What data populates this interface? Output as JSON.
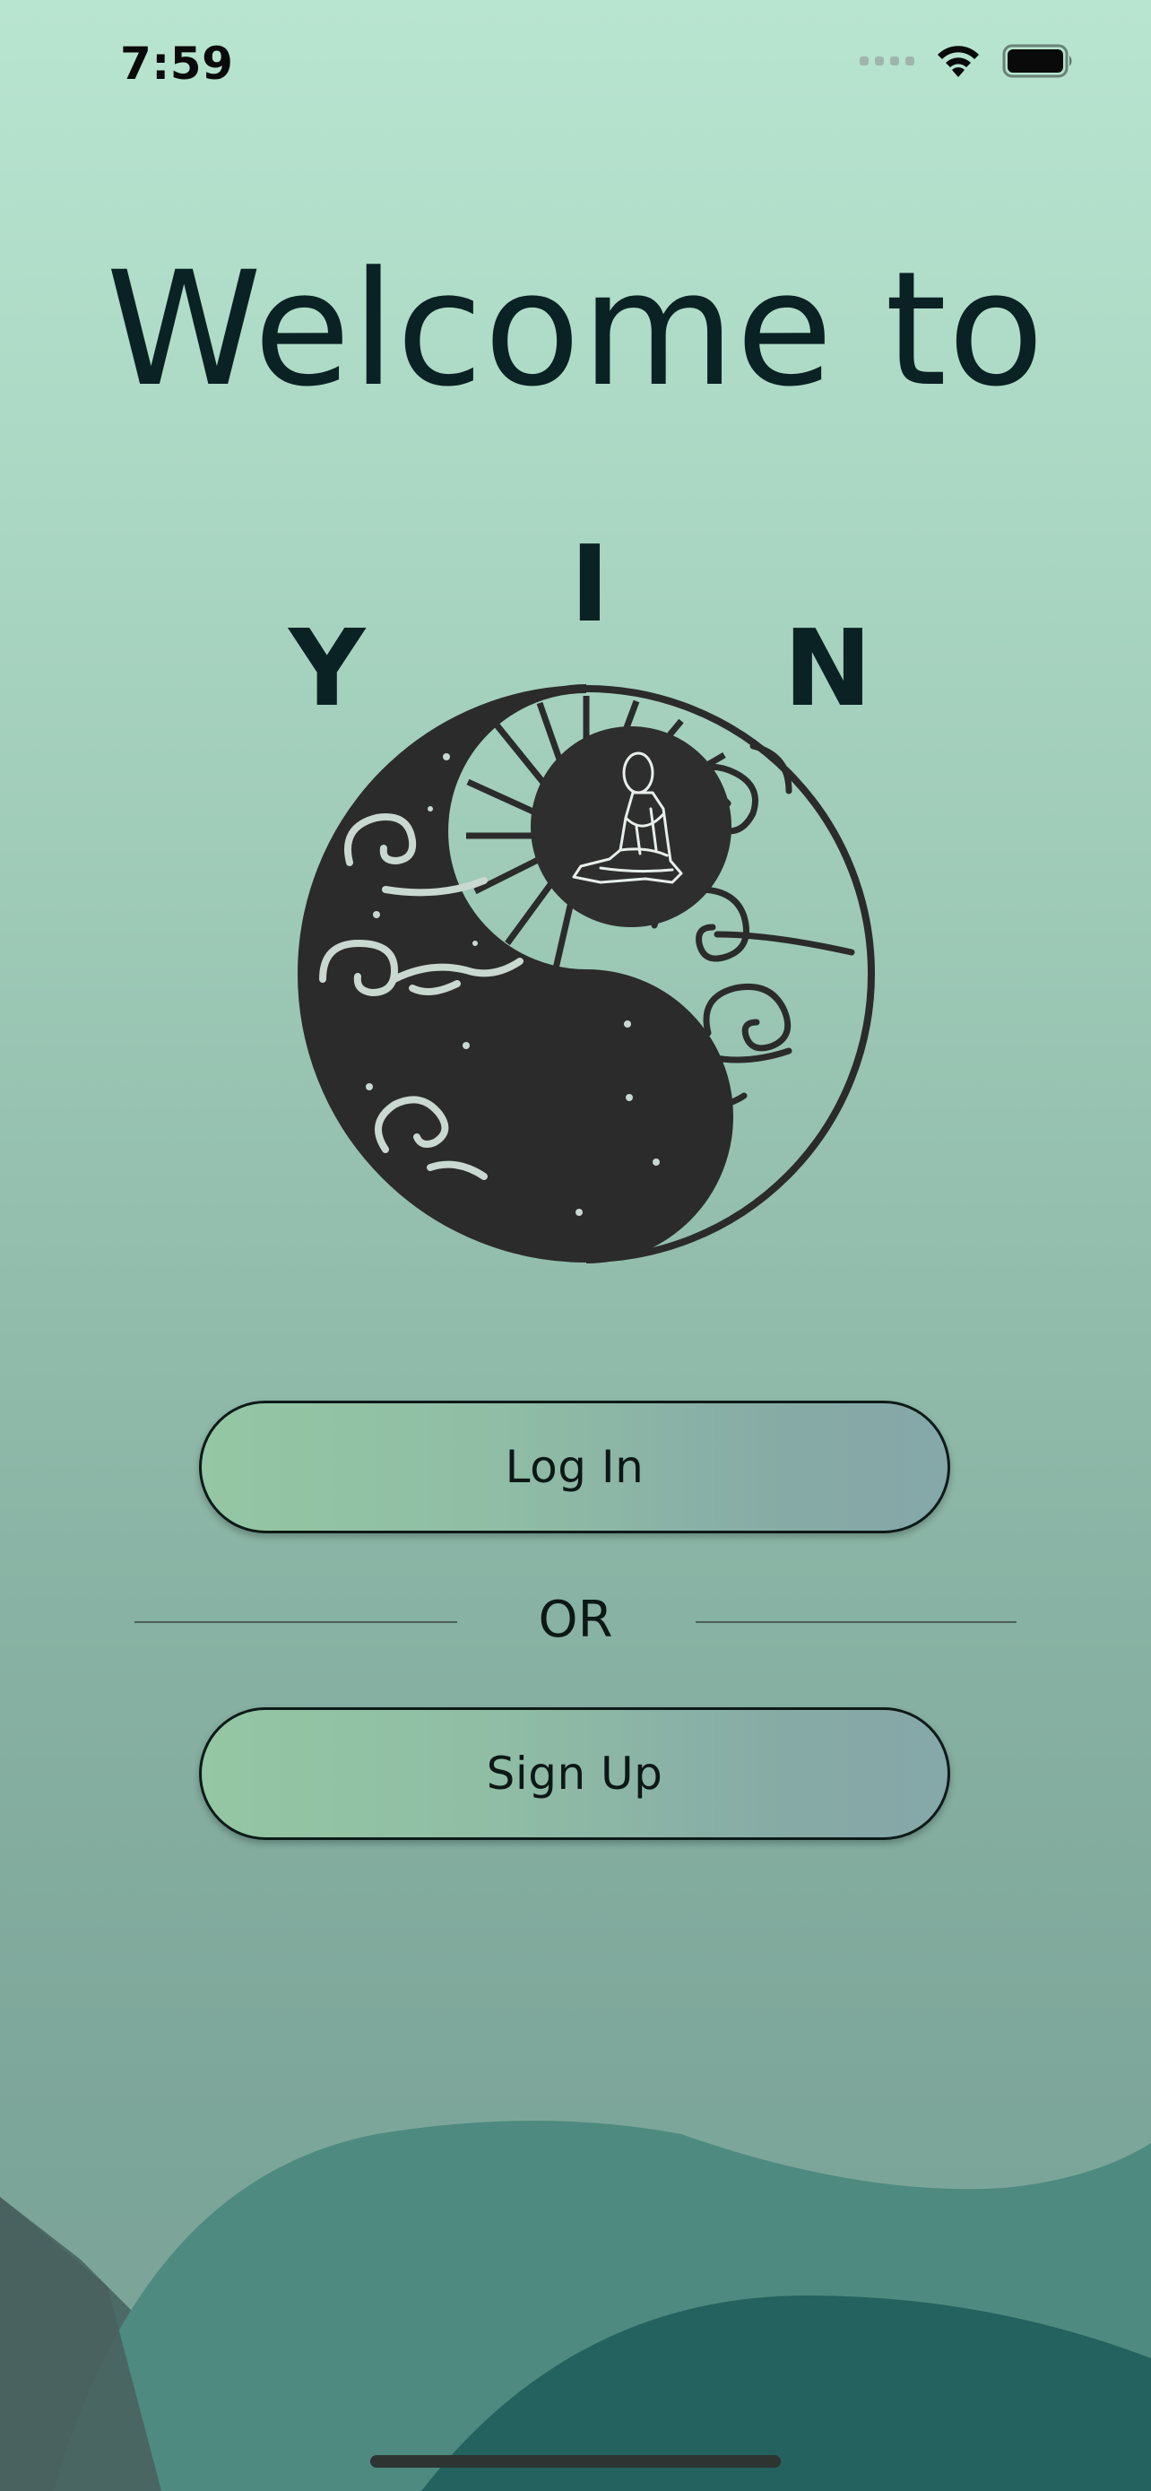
{
  "status_bar": {
    "time": "7:59",
    "icons": [
      "cellular-signal-icon",
      "wifi-icon",
      "battery-icon"
    ]
  },
  "welcome": {
    "heading": "Welcome to",
    "brand_letters": [
      "Y",
      "I",
      "N"
    ]
  },
  "logo": {
    "icon": "yin-yang-meditation-logo"
  },
  "actions": {
    "login_label": "Log In",
    "or_label": "OR",
    "signup_label": "Sign Up"
  },
  "colors": {
    "background_top": "#b8e5d0",
    "background_bottom": "#7aa197",
    "text_dark": "#0b2224",
    "button_gradient_start": "#94c7a4",
    "button_gradient_end": "#85a8a8",
    "wave_light": "#4e8a80",
    "wave_dark": "#22635f",
    "logo_dark": "#2b2b2b"
  }
}
